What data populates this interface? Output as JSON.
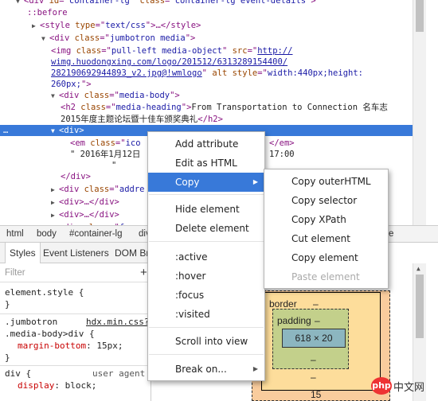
{
  "dom_tree": {
    "rows": [
      {
        "parts": [
          [
            "tri",
            "▼"
          ],
          [
            "tg",
            "<div "
          ],
          [
            "an",
            "id"
          ],
          [
            "tg",
            "=\""
          ],
          [
            "av",
            "container-lg"
          ],
          [
            "tg",
            "\" "
          ],
          [
            "an",
            "class"
          ],
          [
            "tg",
            "=\""
          ],
          [
            "av",
            "container-lg event-details"
          ],
          [
            "tg",
            "\">"
          ]
        ]
      },
      {
        "parts": [
          [
            "ps",
            "::before"
          ]
        ]
      },
      {
        "parts": [
          [
            "tri",
            "▶"
          ],
          [
            "tg",
            "<style "
          ],
          [
            "an",
            "type"
          ],
          [
            "tg",
            "=\""
          ],
          [
            "av",
            "text/css"
          ],
          [
            "tg",
            "\">…</style>"
          ]
        ]
      },
      {
        "parts": [
          [
            "tri",
            "▼"
          ],
          [
            "tg",
            "<div "
          ],
          [
            "an",
            "class"
          ],
          [
            "tg",
            "=\""
          ],
          [
            "av",
            "jumbotron media"
          ],
          [
            "tg",
            "\">"
          ]
        ]
      },
      {
        "parts": [
          [
            "tg",
            "<img "
          ],
          [
            "an",
            "class"
          ],
          [
            "tg",
            "=\""
          ],
          [
            "av",
            "pull-left media-object"
          ],
          [
            "tg",
            "\" "
          ],
          [
            "an",
            "src"
          ],
          [
            "tg",
            "=\""
          ],
          [
            "lk",
            "http://"
          ]
        ]
      },
      {
        "parts": [
          [
            "lk",
            "wimg.huodongxing.com/logo/201512/6313289154400/"
          ]
        ]
      },
      {
        "parts": [
          [
            "lk",
            "282190692944893_v2.jpg@!wmlogo"
          ],
          [
            "tg",
            "\" "
          ],
          [
            "an",
            "alt style"
          ],
          [
            "tg",
            "=\""
          ],
          [
            "av",
            "width:440px;height:"
          ]
        ]
      },
      {
        "parts": [
          [
            "av",
            "260px;"
          ],
          [
            "tg",
            "\">"
          ]
        ]
      },
      {
        "parts": [
          [
            "tri",
            "▼"
          ],
          [
            "tg",
            "<div "
          ],
          [
            "an",
            "class"
          ],
          [
            "tg",
            "=\""
          ],
          [
            "av",
            "media-body"
          ],
          [
            "tg",
            "\">"
          ]
        ]
      },
      {
        "parts": [
          [
            "tg",
            "<h2 "
          ],
          [
            "an",
            "class"
          ],
          [
            "tg",
            "=\""
          ],
          [
            "av",
            "media-heading"
          ],
          [
            "tg",
            "\">"
          ],
          [
            "tx",
            "From Transportation to Connection 名车志"
          ]
        ]
      },
      {
        "parts": [
          [
            "tx",
            "2015年度主题论坛暨十佳车颁奖典礼"
          ],
          [
            "tg",
            "</h2>"
          ]
        ]
      },
      {
        "parts": [
          [
            "tri",
            "▼"
          ],
          [
            "tg",
            "<div>"
          ]
        ]
      },
      {
        "parts": [
          [
            "tg",
            "<em "
          ],
          [
            "an",
            "class"
          ],
          [
            "tg",
            "=\""
          ],
          [
            "av",
            "ico"
          ]
        ]
      },
      {
        "parts": [
          [
            "tx",
            "\" 2016年1月12日"
          ]
        ]
      },
      {
        "parts": [
          [
            "tx",
            "\""
          ]
        ]
      },
      {
        "parts": [
          [
            "tg",
            "</div>"
          ]
        ]
      },
      {
        "parts": [
          [
            "tri",
            "▶"
          ],
          [
            "tg",
            "<div "
          ],
          [
            "an",
            "class"
          ],
          [
            "tg",
            "=\""
          ],
          [
            "av",
            "addre"
          ]
        ]
      },
      {
        "parts": [
          [
            "tri",
            "▶"
          ],
          [
            "tg",
            "<div>…</div>"
          ]
        ]
      },
      {
        "parts": [
          [
            "tri",
            "▶"
          ],
          [
            "tg",
            "<div>…</div>"
          ]
        ]
      },
      {
        "parts": [
          [
            "tri",
            "▶"
          ],
          [
            "tg",
            "<div "
          ],
          [
            "an",
            "class"
          ],
          [
            "tg",
            "=\""
          ],
          [
            "av",
            "func"
          ]
        ]
      }
    ],
    "right_fragments": {
      "em_close": "</em>",
      "time": "17:00"
    },
    "selected_dots": "…"
  },
  "breadcrumbs": [
    "html",
    "body",
    "#container-lg",
    "div",
    "e"
  ],
  "sidebar_tabs": [
    "Styles",
    "Event Listeners",
    "DOM Br"
  ],
  "styles": {
    "filter_placeholder": "Filter",
    "plus": "+",
    "element_style": "element.style {",
    "close_brace": "}",
    "rule2_selector1": ".jumbotron",
    "rule2_source": "hdx.min.css?",
    "rule2_selector2": ".media-body>div {",
    "rule2_prop": "margin-bottom",
    "rule2_value": ": 15px;",
    "rule3_selector": "div {",
    "rule3_source": "user agent",
    "rule3_prop": "display",
    "rule3_value": ": block;"
  },
  "box_model": {
    "border_label": "border",
    "border_value": "–",
    "padding_label": "padding",
    "padding_value": "–",
    "content": "618 × 20",
    "padding_bottom": "–",
    "border_bottom": "–",
    "margin_bottom": "15"
  },
  "watermark": {
    "logo": "php",
    "text": "中文网"
  },
  "context_menu": {
    "items": [
      "Add attribute",
      "Edit as HTML",
      "Copy",
      "Hide element",
      "Delete element",
      ":active",
      ":hover",
      ":focus",
      ":visited",
      "Scroll into view",
      "Break on..."
    ]
  },
  "copy_submenu": {
    "items": [
      "Copy outerHTML",
      "Copy selector",
      "Copy XPath",
      "Cut element",
      "Copy element",
      "Paste element"
    ]
  },
  "colors": {
    "selection": "#3879d9",
    "tag": "#881280",
    "attr_name": "#994500",
    "attr_value": "#1a1aa6"
  }
}
